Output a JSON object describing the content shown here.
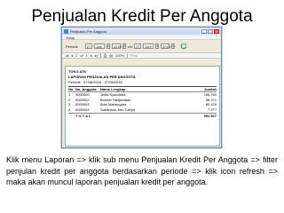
{
  "slide": {
    "title": "Penjualan Kredit Per Anggota",
    "description": "Klik menu Laporan => klik sub menu Penjualan Kredit Per Anggota => filter penjulan kredit per anggota berdasarkan periode => klik icon refresh => maka akan muncul laporan penjualan kredit per anggota."
  },
  "window": {
    "title": "Penjualan Per Anggota",
    "menu": "Tutup",
    "filter": {
      "periode_label": "Periode",
      "from_day": "27",
      "from_month": "Juni",
      "from_year": "2016",
      "separator": "s/d",
      "to_day": "27",
      "to_month": "Juni",
      "to_year": "2016"
    },
    "toolbar": {
      "page_current": "1",
      "page_of": "of",
      "page_total": "1",
      "zoom": "100%",
      "find": "Find"
    }
  },
  "report": {
    "store": "TOKO ATK",
    "title": "LAPORAN PENJUALAN PER ANGGOTA",
    "period": "Periode : 07/06/2016 - 27/06/2016",
    "headers": [
      "No",
      "No. Anggota",
      "Nama Lengkap",
      "",
      "Jumlah"
    ],
    "rows": [
      [
        "1",
        "0000000",
        "Jelita Syaodhha",
        "",
        "166.760"
      ],
      [
        "2",
        "0000002",
        "Bonner Hadjanatas",
        "",
        "96.071"
      ],
      [
        "3",
        "0000003",
        "Ariel Mahengara",
        "",
        "82.420"
      ],
      [
        "4",
        "0000004",
        "Suriantoro Eko Cahyo",
        "",
        "7.277"
      ]
    ],
    "total_label": "T O T A L",
    "total_value": "352.527"
  }
}
